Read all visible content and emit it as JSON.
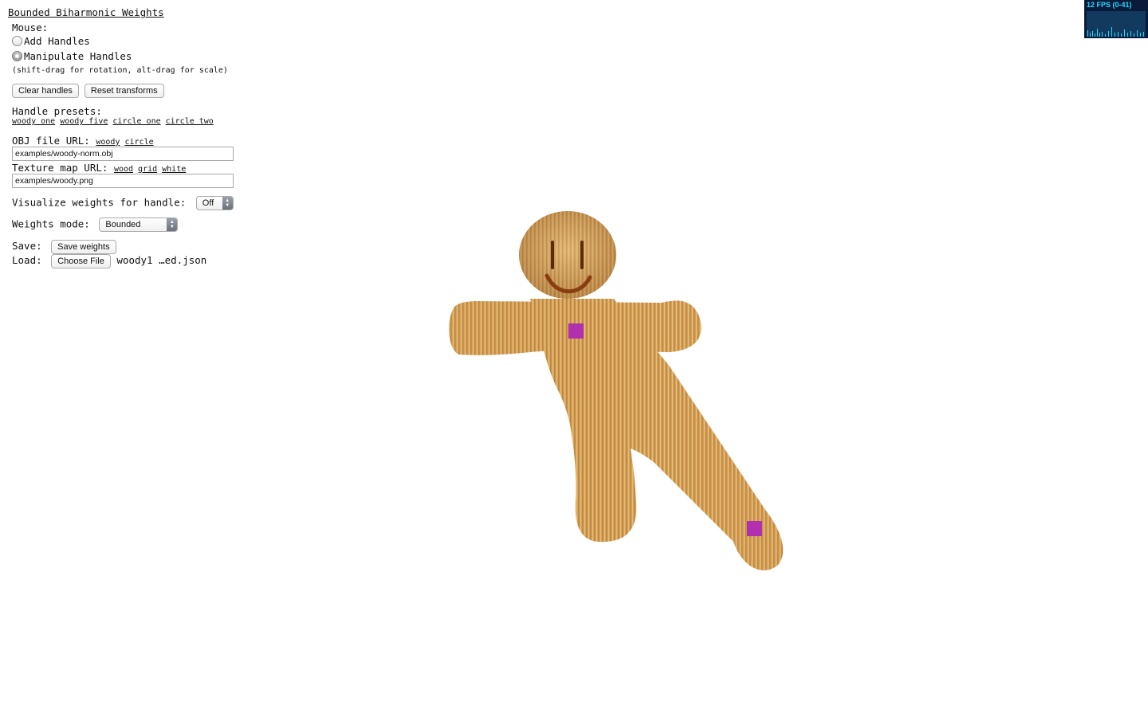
{
  "app": {
    "title": "Bounded Biharmonic Weights"
  },
  "mouse": {
    "label": "Mouse:",
    "options": [
      {
        "label": "Add Handles",
        "checked": false
      },
      {
        "label": "Manipulate Handles",
        "checked": true
      }
    ],
    "hint": "(shift-drag for rotation, alt-drag for scale)"
  },
  "buttons": {
    "clear_handles": "Clear handles",
    "reset_transforms": "Reset transforms"
  },
  "presets": {
    "label": "Handle presets:",
    "items": [
      "woody one",
      "woody five",
      "circle one",
      "circle two"
    ]
  },
  "obj": {
    "label": "OBJ file URL:",
    "links": [
      "woody",
      "circle"
    ],
    "value": "examples/woody-norm.obj"
  },
  "texture": {
    "label": "Texture map URL:",
    "links": [
      "wood",
      "grid",
      "white"
    ],
    "value": "examples/woody.png"
  },
  "visualize": {
    "label": "Visualize weights for handle:",
    "selected": "Off"
  },
  "weights_mode": {
    "label": "Weights mode:",
    "selected": "Bounded"
  },
  "save": {
    "label": "Save:",
    "button": "Save weights"
  },
  "load": {
    "label": "Load:",
    "button": "Choose File",
    "filename": "woody1 …ed.json"
  },
  "fps": {
    "label": "12 FPS (0-41)"
  },
  "colors": {
    "handle": "#b030b0",
    "wood": "#d9a862",
    "fps_text": "#27d7ff"
  },
  "icons": [
    "radio-icon",
    "select-arrows-icon",
    "handle-square-icon"
  ]
}
